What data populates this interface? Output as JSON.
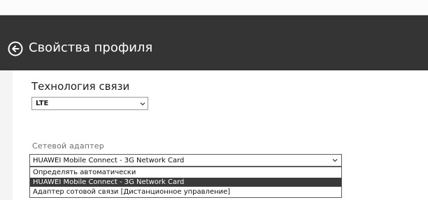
{
  "header": {
    "title": "Свойства профиля",
    "back_icon": "back-arrow-circle-icon"
  },
  "technology": {
    "label": "Технология связи",
    "value": "LTE"
  },
  "adapter": {
    "label": "Сетевой адаптер",
    "value": "HUAWEI Mobile Connect - 3G Network Card",
    "options": [
      "Определять автоматически",
      "HUAWEI Mobile Connect - 3G Network Card",
      "Адаптер сотовой связи [Дистанционное управление]"
    ],
    "selected_index": 1
  },
  "colors": {
    "header_bg": "#343434",
    "selected_option_bg": "#3a3a3a"
  }
}
